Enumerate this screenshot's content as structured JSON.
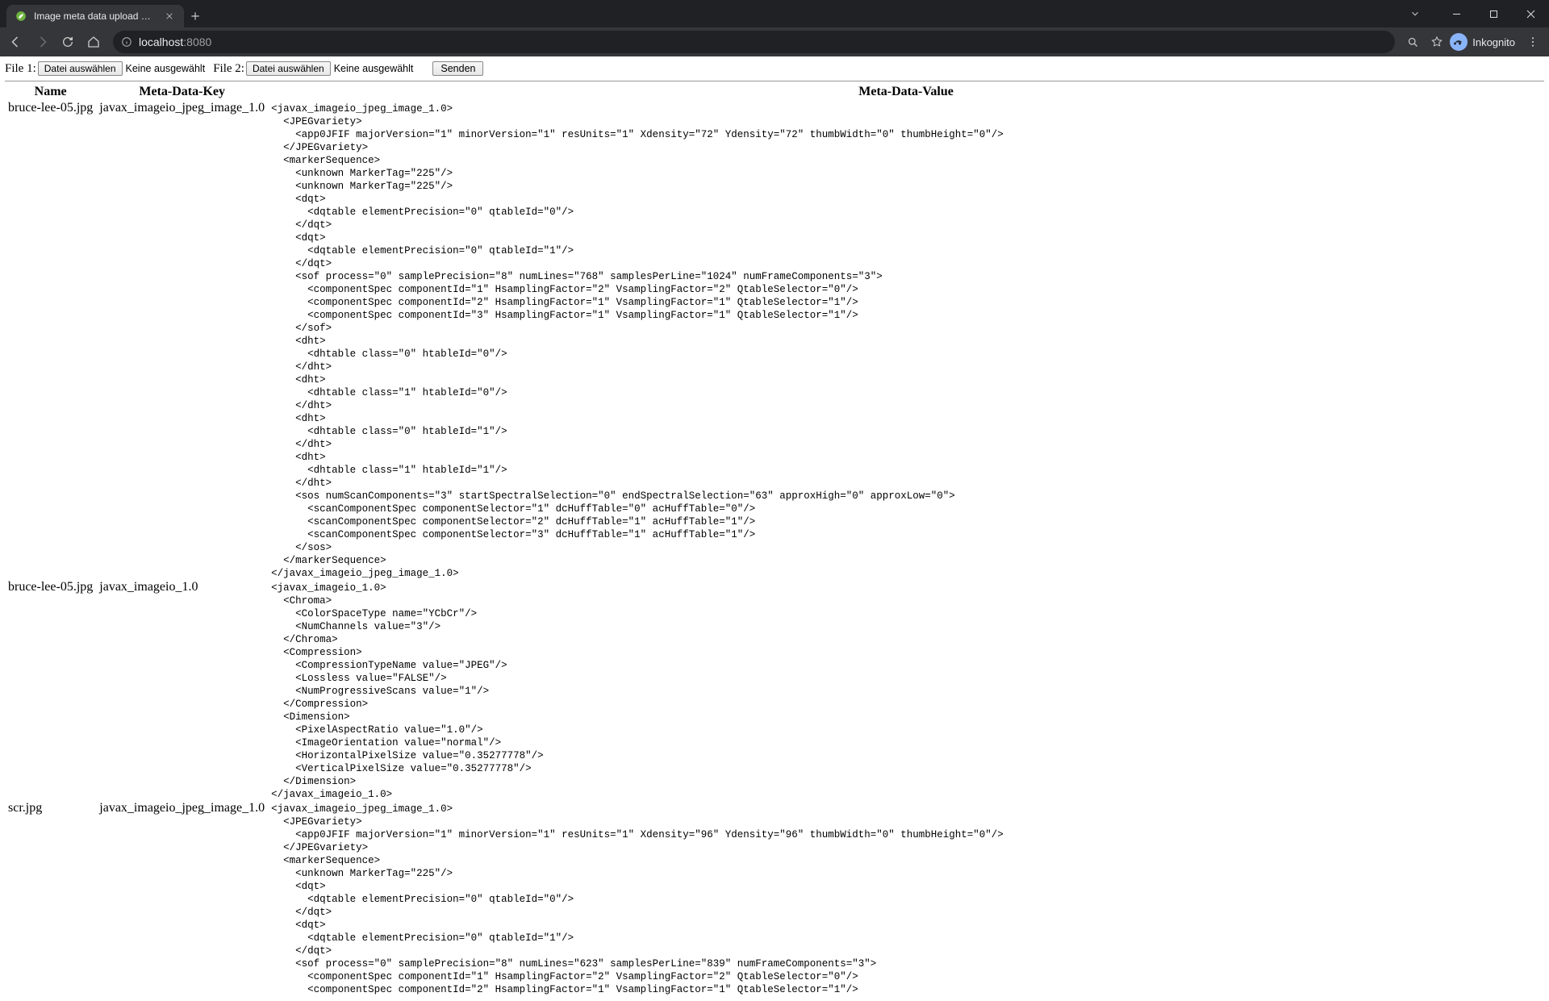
{
  "browser": {
    "tab_title": "Image meta data upload Exampl",
    "profile_label": "Inkognito"
  },
  "address": {
    "domain": "localhost",
    "port": ":8080"
  },
  "form": {
    "file1_label": "File 1:",
    "file2_label": "File 2:",
    "choose_button": "Datei auswählen",
    "no_file": "Keine ausgewählt",
    "submit_label": "Senden"
  },
  "table": {
    "headers": {
      "name": "Name",
      "key": "Meta-Data-Key",
      "value": "Meta-Data-Value"
    },
    "rows": [
      {
        "name": "bruce-lee-05.jpg",
        "key": "javax_imageio_jpeg_image_1.0",
        "value": "<javax_imageio_jpeg_image_1.0>\n  <JPEGvariety>\n    <app0JFIF majorVersion=\"1\" minorVersion=\"1\" resUnits=\"1\" Xdensity=\"72\" Ydensity=\"72\" thumbWidth=\"0\" thumbHeight=\"0\"/>\n  </JPEGvariety>\n  <markerSequence>\n    <unknown MarkerTag=\"225\"/>\n    <unknown MarkerTag=\"225\"/>\n    <dqt>\n      <dqtable elementPrecision=\"0\" qtableId=\"0\"/>\n    </dqt>\n    <dqt>\n      <dqtable elementPrecision=\"0\" qtableId=\"1\"/>\n    </dqt>\n    <sof process=\"0\" samplePrecision=\"8\" numLines=\"768\" samplesPerLine=\"1024\" numFrameComponents=\"3\">\n      <componentSpec componentId=\"1\" HsamplingFactor=\"2\" VsamplingFactor=\"2\" QtableSelector=\"0\"/>\n      <componentSpec componentId=\"2\" HsamplingFactor=\"1\" VsamplingFactor=\"1\" QtableSelector=\"1\"/>\n      <componentSpec componentId=\"3\" HsamplingFactor=\"1\" VsamplingFactor=\"1\" QtableSelector=\"1\"/>\n    </sof>\n    <dht>\n      <dhtable class=\"0\" htableId=\"0\"/>\n    </dht>\n    <dht>\n      <dhtable class=\"1\" htableId=\"0\"/>\n    </dht>\n    <dht>\n      <dhtable class=\"0\" htableId=\"1\"/>\n    </dht>\n    <dht>\n      <dhtable class=\"1\" htableId=\"1\"/>\n    </dht>\n    <sos numScanComponents=\"3\" startSpectralSelection=\"0\" endSpectralSelection=\"63\" approxHigh=\"0\" approxLow=\"0\">\n      <scanComponentSpec componentSelector=\"1\" dcHuffTable=\"0\" acHuffTable=\"0\"/>\n      <scanComponentSpec componentSelector=\"2\" dcHuffTable=\"1\" acHuffTable=\"1\"/>\n      <scanComponentSpec componentSelector=\"3\" dcHuffTable=\"1\" acHuffTable=\"1\"/>\n    </sos>\n  </markerSequence>\n</javax_imageio_jpeg_image_1.0>\n"
      },
      {
        "name": "bruce-lee-05.jpg",
        "key": "javax_imageio_1.0",
        "value": "<javax_imageio_1.0>\n  <Chroma>\n    <ColorSpaceType name=\"YCbCr\"/>\n    <NumChannels value=\"3\"/>\n  </Chroma>\n  <Compression>\n    <CompressionTypeName value=\"JPEG\"/>\n    <Lossless value=\"FALSE\"/>\n    <NumProgressiveScans value=\"1\"/>\n  </Compression>\n  <Dimension>\n    <PixelAspectRatio value=\"1.0\"/>\n    <ImageOrientation value=\"normal\"/>\n    <HorizontalPixelSize value=\"0.35277778\"/>\n    <VerticalPixelSize value=\"0.35277778\"/>\n  </Dimension>\n</javax_imageio_1.0>\n"
      },
      {
        "name": "scr.jpg",
        "key": "javax_imageio_jpeg_image_1.0",
        "value": "<javax_imageio_jpeg_image_1.0>\n  <JPEGvariety>\n    <app0JFIF majorVersion=\"1\" minorVersion=\"1\" resUnits=\"1\" Xdensity=\"96\" Ydensity=\"96\" thumbWidth=\"0\" thumbHeight=\"0\"/>\n  </JPEGvariety>\n  <markerSequence>\n    <unknown MarkerTag=\"225\"/>\n    <dqt>\n      <dqtable elementPrecision=\"0\" qtableId=\"0\"/>\n    </dqt>\n    <dqt>\n      <dqtable elementPrecision=\"0\" qtableId=\"1\"/>\n    </dqt>\n    <sof process=\"0\" samplePrecision=\"8\" numLines=\"623\" samplesPerLine=\"839\" numFrameComponents=\"3\">\n      <componentSpec componentId=\"1\" HsamplingFactor=\"2\" VsamplingFactor=\"2\" QtableSelector=\"0\"/>\n      <componentSpec componentId=\"2\" HsamplingFactor=\"1\" VsamplingFactor=\"1\" QtableSelector=\"1\"/>"
      }
    ]
  }
}
